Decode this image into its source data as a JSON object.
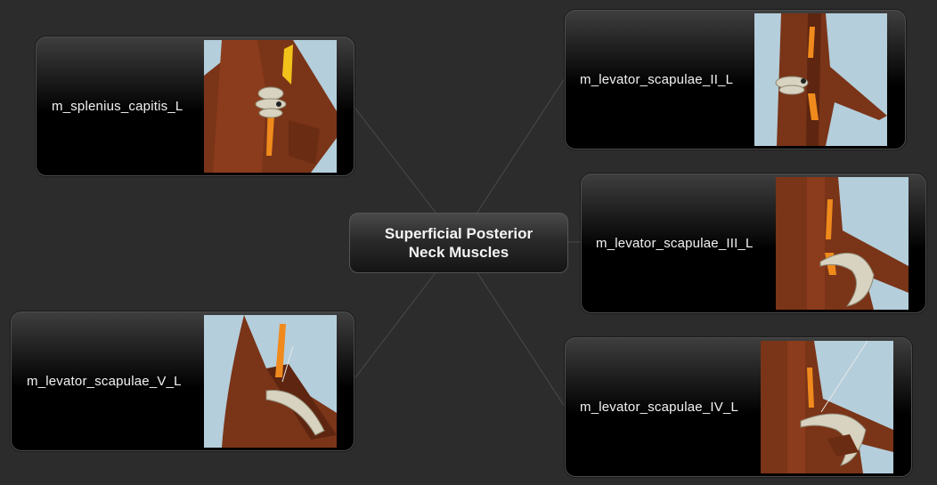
{
  "central_topic": "Superficial Posterior\nNeck Muscles",
  "nodes": [
    {
      "label": "m_splenius_capitis_L",
      "thumbnail": "splenius-capitis-render"
    },
    {
      "label": "m_levator_scapulae_II_L",
      "thumbnail": "levator-scapulae-ii-render"
    },
    {
      "label": "m_levator_scapulae_III_L",
      "thumbnail": "levator-scapulae-iii-render"
    },
    {
      "label": "m_levator_scapulae_V_L",
      "thumbnail": "levator-scapulae-v-render"
    },
    {
      "label": "m_levator_scapulae_IV_L",
      "thumbnail": "levator-scapulae-iv-render"
    }
  ],
  "colors": {
    "background": "#2c2c2c",
    "muscle": "#7a3418",
    "highlight": "#f08a1c",
    "bone": "#d8d2c0",
    "sky": "#b4cedb"
  }
}
